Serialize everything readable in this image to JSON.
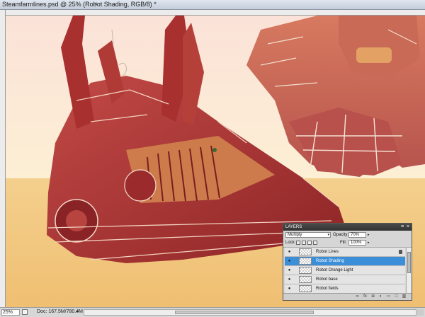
{
  "window": {
    "title": "Steamfarmlines.psd @ 25% (Robot Shading, RGB/8) *",
    "close_glyph": "×"
  },
  "status": {
    "zoom": "25%",
    "doc_size": "Doc: 167.5M/780.4M",
    "arrow_glyph": "▸"
  },
  "layers_panel": {
    "title": "LAYERS",
    "menu_glyph": "≡",
    "close_glyph": "×",
    "blend_mode": "Multiply",
    "opacity_label": "Opacity:",
    "opacity_value": "70%",
    "lock_label": "Lock:",
    "fill_label": "Fill:",
    "fill_value": "100%",
    "layers": [
      {
        "name": "Robot Lines",
        "visible": true,
        "locked": true,
        "selected": false
      },
      {
        "name": "Robot Shading",
        "visible": true,
        "locked": false,
        "selected": true
      },
      {
        "name": "Robot Orange Light",
        "visible": true,
        "locked": false,
        "selected": false
      },
      {
        "name": "Robot base",
        "visible": true,
        "locked": false,
        "selected": false
      },
      {
        "name": "Robot fields",
        "visible": true,
        "locked": false,
        "selected": false
      }
    ],
    "footer_icons": [
      "link-icon",
      "fx-icon",
      "mask-icon",
      "adjustment-icon",
      "group-icon",
      "new-layer-icon",
      "trash-icon"
    ]
  },
  "colors": {
    "sky": "#fbe9cc",
    "ground": "#f2c77f",
    "robot_dark": "#9b2a2c",
    "robot_mid": "#c2484a",
    "robot_light": "#e08a62",
    "selection": "#3b8fd8"
  }
}
